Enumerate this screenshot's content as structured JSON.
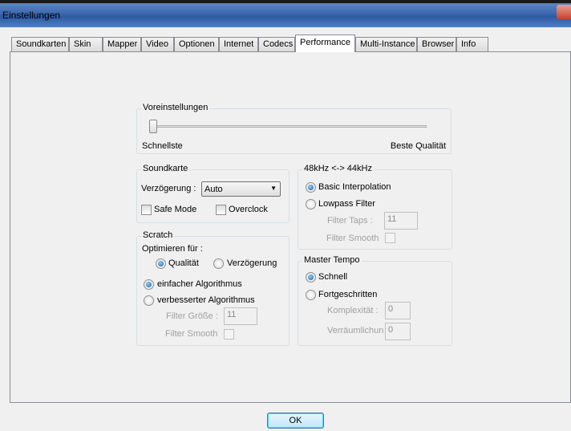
{
  "window": {
    "title": "Einstellungen"
  },
  "tabs": [
    "Soundkarten",
    "Skin",
    "Mapper",
    "Video",
    "Optionen",
    "Internet",
    "Codecs",
    "Performance",
    "Multi-Instance",
    "Browser",
    "Info"
  ],
  "active_tab": "Performance",
  "presets": {
    "title": "Voreinstellungen",
    "min_label": "Schnellste",
    "max_label": "Beste Qualität",
    "slider_value": 0
  },
  "soundcard": {
    "title": "Soundkarte",
    "latency_label": "Verzögerung :",
    "latency_value": "Auto",
    "safe_mode": "Safe Mode",
    "overclock": "Overclock"
  },
  "scratch": {
    "title": "Scratch",
    "optimize_label": "Optimieren für :",
    "quality": "Qualität",
    "latency": "Verzögerung",
    "simple": "einfacher Algorithmus",
    "improved": "verbesserter Algorithmus",
    "filter_size_label": "Filter Größe :",
    "filter_size_value": "11",
    "filter_smooth": "Filter Smooth"
  },
  "resample": {
    "title": "48kHz <-> 44kHz",
    "basic": "Basic Interpolation",
    "lowpass": "Lowpass Filter",
    "taps_label": "Filter Taps :",
    "taps_value": "11",
    "filter_smooth": "Filter Smooth"
  },
  "master_tempo": {
    "title": "Master Tempo",
    "fast": "Schnell",
    "advanced": "Fortgeschritten",
    "complexity_label": "Komplexität :",
    "complexity_value": "0",
    "spatial_label": "Verräumlichung",
    "spatial_value": "0"
  },
  "ok_label": "OK"
}
